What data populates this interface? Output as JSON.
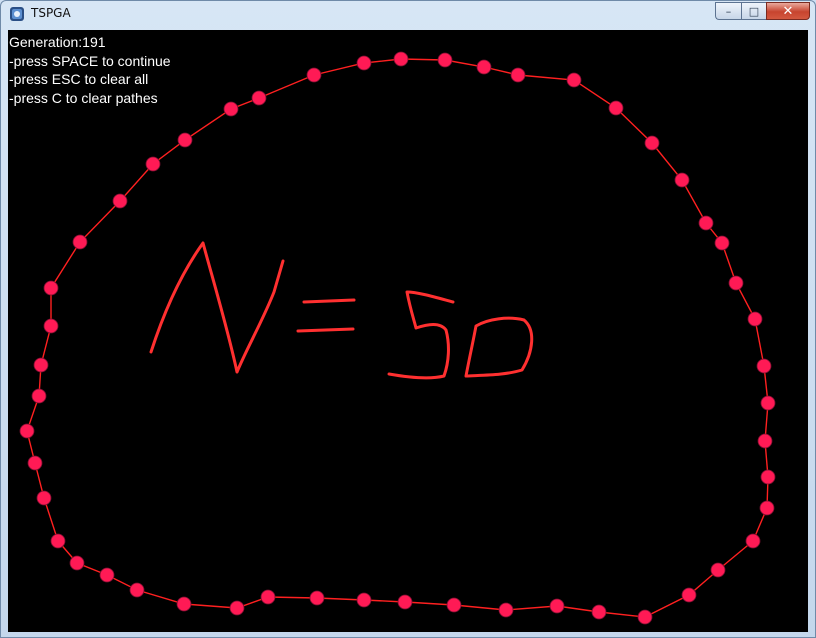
{
  "window": {
    "title": "TSPGA",
    "controls": {
      "minimize": "–",
      "maximize": "□",
      "close": "✕"
    }
  },
  "hud": {
    "generation_label": "Generation:191",
    "instructions": [
      "-press SPACE to continue",
      "-press ESC to clear all",
      "-press C to clear pathes"
    ]
  },
  "canvas": {
    "background": "#000000",
    "path_color": "#ff2020",
    "node_color": "#ff1a55",
    "handwriting_color": "#ff3030",
    "handwritten_note": "N=50",
    "city_count": 50
  }
}
